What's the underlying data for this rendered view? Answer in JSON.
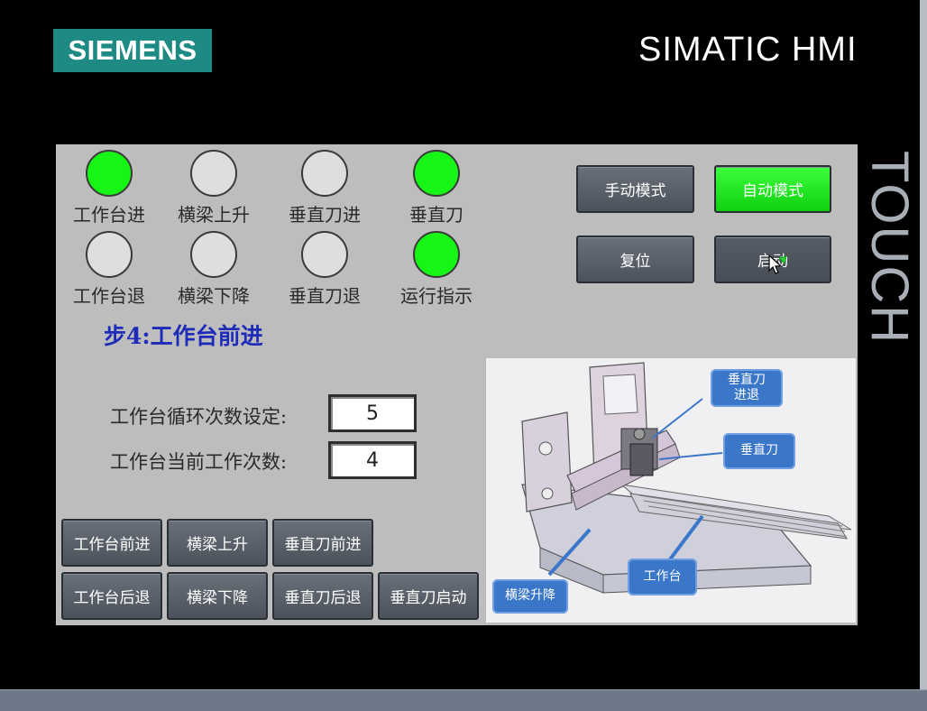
{
  "header": {
    "logo_text": "SIEMENS",
    "product_title": "SIMATIC HMI",
    "side_label": "TOUCH"
  },
  "indicators": [
    {
      "label": "工作台进",
      "state": "on"
    },
    {
      "label": "横梁上升",
      "state": "off"
    },
    {
      "label": "垂直刀进",
      "state": "off"
    },
    {
      "label": "垂直刀",
      "state": "on"
    },
    {
      "label": "工作台退",
      "state": "off"
    },
    {
      "label": "横梁下降",
      "state": "off"
    },
    {
      "label": "垂直刀退",
      "state": "off"
    },
    {
      "label": "运行指示",
      "state": "on"
    }
  ],
  "mode_buttons": {
    "manual": "手动模式",
    "auto": "自动模式",
    "reset": "复位",
    "start": "启动"
  },
  "step_text": "步4:工作台前进",
  "fields": {
    "cycle_set_label": "工作台循环次数设定:",
    "cycle_set_value": "5",
    "current_count_label": "工作台当前工作次数:",
    "current_count_value": "4"
  },
  "manual_buttons": {
    "table_forward": "工作台前进",
    "beam_up": "横梁上升",
    "knife_forward": "垂直刀前进",
    "table_back": "工作台后退",
    "beam_down": "横梁下降",
    "knife_back": "垂直刀后退",
    "knife_start": "垂直刀启动"
  },
  "diagram_callouts": {
    "knife_feed": "垂直刀\n进退",
    "knife": "垂直刀",
    "beam": "横梁升降",
    "table": "工作台"
  },
  "colors": {
    "lamp_on": "#16f516",
    "lamp_off": "#dedede",
    "logo": "#1e8a84",
    "step_text": "#1d2bb8"
  }
}
